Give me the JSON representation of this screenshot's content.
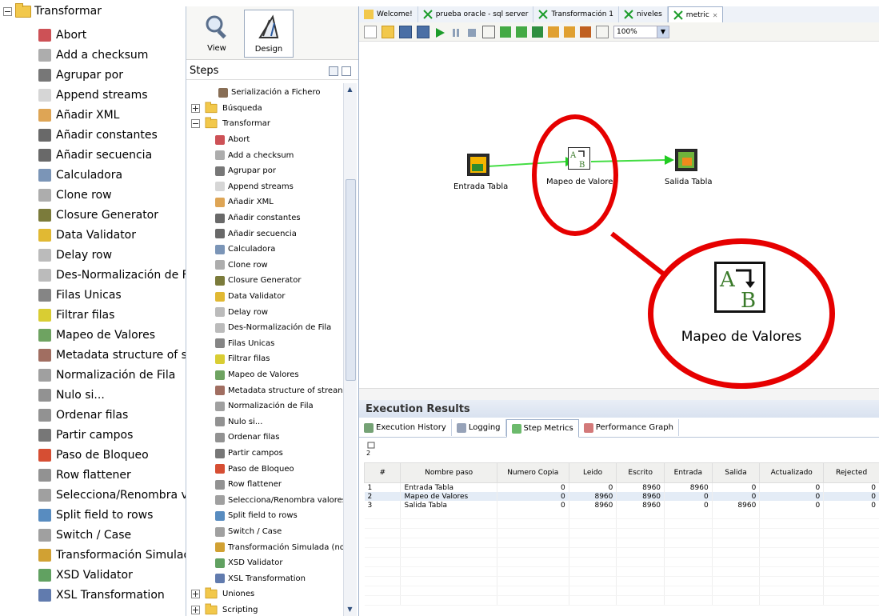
{
  "big_tree": {
    "root_label": "Transformar",
    "items": [
      {
        "label": "Abort",
        "icon": "abort-icon"
      },
      {
        "label": "Add a checksum",
        "icon": "checksum-icon"
      },
      {
        "label": "Agrupar por",
        "icon": "group-by-icon"
      },
      {
        "label": "Append streams",
        "icon": "append-icon"
      },
      {
        "label": "Añadir XML",
        "icon": "xml-icon"
      },
      {
        "label": "Añadir constantes",
        "icon": "constants-icon"
      },
      {
        "label": "Añadir secuencia",
        "icon": "sequence-icon"
      },
      {
        "label": "Calculadora",
        "icon": "calculator-icon"
      },
      {
        "label": "Clone row",
        "icon": "clone-icon"
      },
      {
        "label": "Closure Generator",
        "icon": "closure-icon"
      },
      {
        "label": "Data Validator",
        "icon": "validator-icon"
      },
      {
        "label": "Delay row",
        "icon": "delay-icon"
      },
      {
        "label": "Des-Normalización de Fila",
        "icon": "denormalize-icon"
      },
      {
        "label": "Filas Unicas",
        "icon": "unique-icon"
      },
      {
        "label": "Filtrar filas",
        "icon": "filter-icon"
      },
      {
        "label": "Mapeo de Valores",
        "icon": "value-mapper-icon"
      },
      {
        "label": "Metadata structure of strean",
        "icon": "metadata-icon"
      },
      {
        "label": "Normalización de Fila",
        "icon": "normalize-icon"
      },
      {
        "label": "Nulo si...",
        "icon": "null-if-icon"
      },
      {
        "label": "Ordenar filas",
        "icon": "sort-icon"
      },
      {
        "label": "Partir campos",
        "icon": "split-icon"
      },
      {
        "label": "Paso de Bloqueo",
        "icon": "block-icon"
      },
      {
        "label": "Row flattener",
        "icon": "flatten-icon"
      },
      {
        "label": "Selecciona/Renombra valores",
        "icon": "select-icon"
      },
      {
        "label": "Split field to rows",
        "icon": "split-rows-icon"
      },
      {
        "label": "Switch / Case",
        "icon": "switch-icon"
      },
      {
        "label": "Transformación Simulada (no",
        "icon": "dummy-icon"
      },
      {
        "label": "XSD Validator",
        "icon": "xsd-icon"
      },
      {
        "label": "XSL Transformation",
        "icon": "xsl-icon"
      }
    ]
  },
  "mode_bar": {
    "view_label": "View",
    "design_label": "Design"
  },
  "steps_panel": {
    "title": "Steps",
    "items_before": [
      {
        "label": "Serialización a Fichero",
        "level": 2
      },
      {
        "label": "Búsqueda",
        "level": 1,
        "folder": true
      },
      {
        "label": "Transformar",
        "level": 1,
        "folder": true,
        "expanded": true
      }
    ],
    "items": [
      "Abort",
      "Add a checksum",
      "Agrupar por",
      "Append streams",
      "Añadir XML",
      "Añadir constantes",
      "Añadir secuencia",
      "Calculadora",
      "Clone row",
      "Closure Generator",
      "Data Validator",
      "Delay row",
      "Des-Normalización de Fila",
      "Filas Unicas",
      "Filtrar filas",
      "Mapeo de Valores",
      "Metadata structure of strean",
      "Normalización de Fila",
      "Nulo si...",
      "Ordenar filas",
      "Partir campos",
      "Paso de Bloqueo",
      "Row flattener",
      "Selecciona/Renombra valores",
      "Split field to rows",
      "Switch / Case",
      "Transformación Simulada (no",
      "XSD Validator",
      "XSL Transformation"
    ],
    "items_after": [
      {
        "label": "Uniones",
        "folder": true
      },
      {
        "label": "Scripting",
        "folder": true
      }
    ]
  },
  "editor": {
    "tabs": [
      {
        "label": "Welcome!"
      },
      {
        "label": "prueba oracle - sql server"
      },
      {
        "label": "Transformación 1"
      },
      {
        "label": "niveles"
      },
      {
        "label": "metric"
      }
    ],
    "zoom": "100%"
  },
  "canvas": {
    "nodes": [
      {
        "label": "Entrada Tabla",
        "icon": "table-input-icon"
      },
      {
        "label": "Mapeo de Valores",
        "icon": "value-mapper-icon"
      },
      {
        "label": "Salida Tabla",
        "icon": "table-output-icon"
      }
    ],
    "callout_label": "Mapeo de Valores"
  },
  "results": {
    "title": "Execution Results",
    "tabs": [
      "Execution History",
      "Logging",
      "Step Metrics",
      "Performance Graph"
    ],
    "active_tab": "Step Metrics",
    "columns": [
      "#",
      "Nombre paso",
      "Numero Copia",
      "Leido",
      "Escrito",
      "Entrada",
      "Salida",
      "Actualizado",
      "Rejected"
    ],
    "rows": [
      [
        "1",
        "Entrada Tabla",
        "0",
        "0",
        "8960",
        "8960",
        "0",
        "0",
        "0"
      ],
      [
        "2",
        "Mapeo de Valores",
        "0",
        "8960",
        "8960",
        "0",
        "0",
        "0",
        "0"
      ],
      [
        "3",
        "Salida Tabla",
        "0",
        "8960",
        "8960",
        "0",
        "8960",
        "0",
        "0"
      ]
    ]
  },
  "colors": {
    "callout": "#e60000",
    "hop": "#22cc22",
    "folder": "#f2c84b"
  }
}
